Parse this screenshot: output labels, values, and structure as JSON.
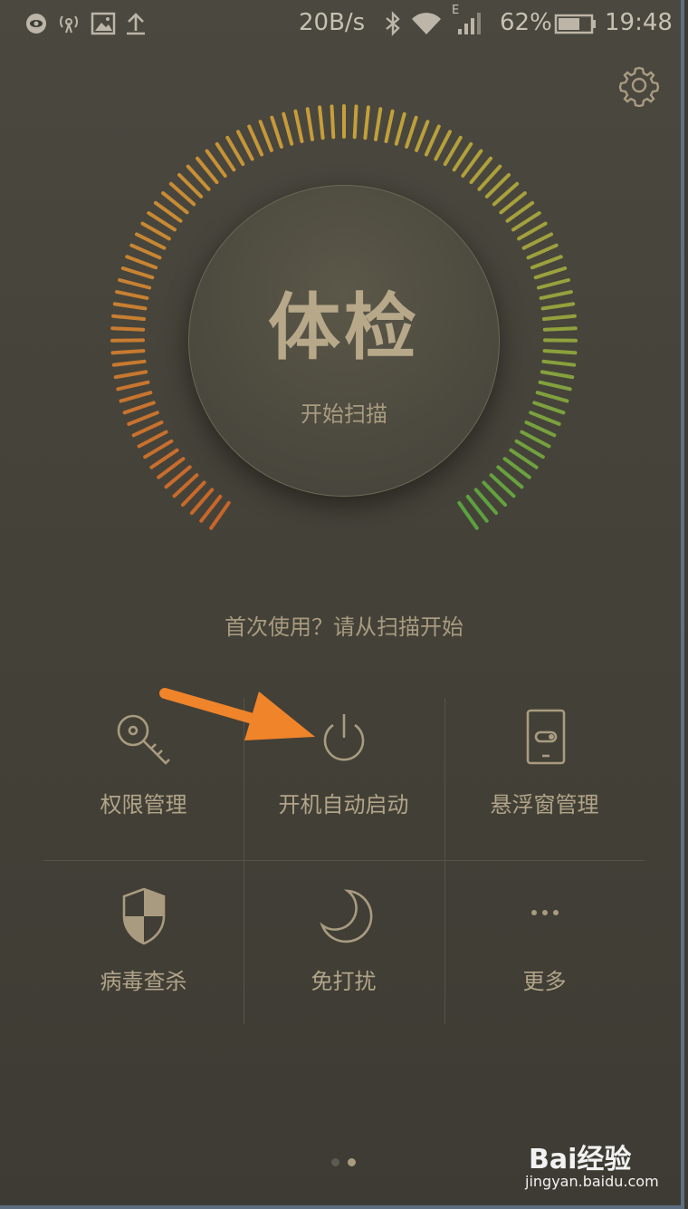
{
  "statusbar": {
    "speed": "20B/s",
    "network_type": "E",
    "battery": "62%",
    "time": "19:48",
    "icons": [
      "eye-icon",
      "hotspot-icon",
      "image-icon",
      "upload-icon",
      "bluetooth-icon",
      "wifi-icon",
      "signal-icon",
      "battery-icon"
    ]
  },
  "header": {
    "settings_icon": "gear-icon"
  },
  "scan": {
    "title": "体检",
    "subtitle": "开始扫描",
    "hint": "首次使用？请从扫描开始"
  },
  "dial_colors": {
    "start": "#c9652a",
    "mid": "#c7a03a",
    "end": "#5aa13f"
  },
  "tools": [
    {
      "label": "权限管理",
      "icon": "key-icon"
    },
    {
      "label": "开机自动启动",
      "icon": "power-icon"
    },
    {
      "label": "悬浮窗管理",
      "icon": "floating-window-icon"
    },
    {
      "label": "病毒查杀",
      "icon": "shield-icon"
    },
    {
      "label": "免打扰",
      "icon": "moon-icon"
    },
    {
      "label": "更多",
      "icon": "more-icon"
    }
  ],
  "annotation": {
    "arrow_color": "#f0842a"
  },
  "pager": {
    "pages": 2,
    "current": 2
  },
  "watermark": {
    "brand": "Bai经验",
    "url": "jingyan.baidu.com"
  }
}
